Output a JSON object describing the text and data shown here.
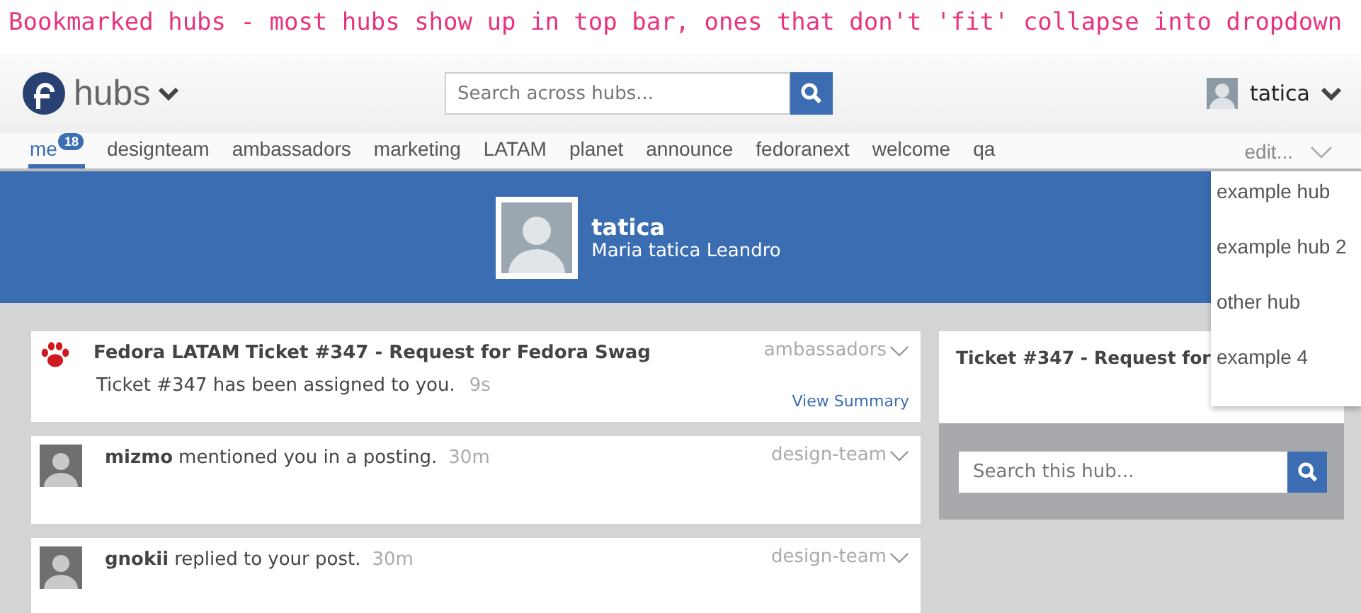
{
  "caption": "Bookmarked hubs - most hubs show up in top bar, ones that don't 'fit' collapse into dropdown",
  "header": {
    "app_name": "hubs",
    "search": {
      "placeholder": "Search across hubs..."
    },
    "user": {
      "name": "tatica"
    }
  },
  "tabs": [
    {
      "label": "me",
      "badge": "18",
      "selected": true
    },
    {
      "label": "designteam",
      "selected": false
    },
    {
      "label": "ambassadors",
      "selected": false
    },
    {
      "label": "marketing",
      "selected": false
    },
    {
      "label": "LATAM",
      "selected": false
    },
    {
      "label": "planet",
      "selected": false
    },
    {
      "label": "announce",
      "selected": false
    },
    {
      "label": "fedoranext",
      "selected": false
    },
    {
      "label": "welcome",
      "selected": false
    },
    {
      "label": "qa",
      "selected": false
    }
  ],
  "edit_menu": {
    "label": "edit...",
    "expanded": true,
    "items": [
      "example hub",
      "example hub 2",
      "other hub",
      "example 4"
    ]
  },
  "profile": {
    "username": "tatica",
    "full_name": "Maria tatica Leandro"
  },
  "feed": [
    {
      "kind": "ticket",
      "author": "Fedora LATAM",
      "title": "Ticket #347 - Request for Fedora Swag",
      "message": "Ticket #347 has been assigned to you.",
      "time": "9s",
      "hub": "ambassadors",
      "link": "View Summary"
    },
    {
      "kind": "person",
      "author": "mizmo",
      "message": "mentioned you in a posting.",
      "time": "30m",
      "hub": "design-team"
    },
    {
      "kind": "person",
      "author": "gnokii",
      "message": "replied to your post.",
      "time": "30m",
      "hub": "design-team"
    }
  ],
  "sidebar": {
    "card_title": "Ticket #347 - Request for",
    "search": {
      "placeholder": "Search this hub..."
    }
  }
}
